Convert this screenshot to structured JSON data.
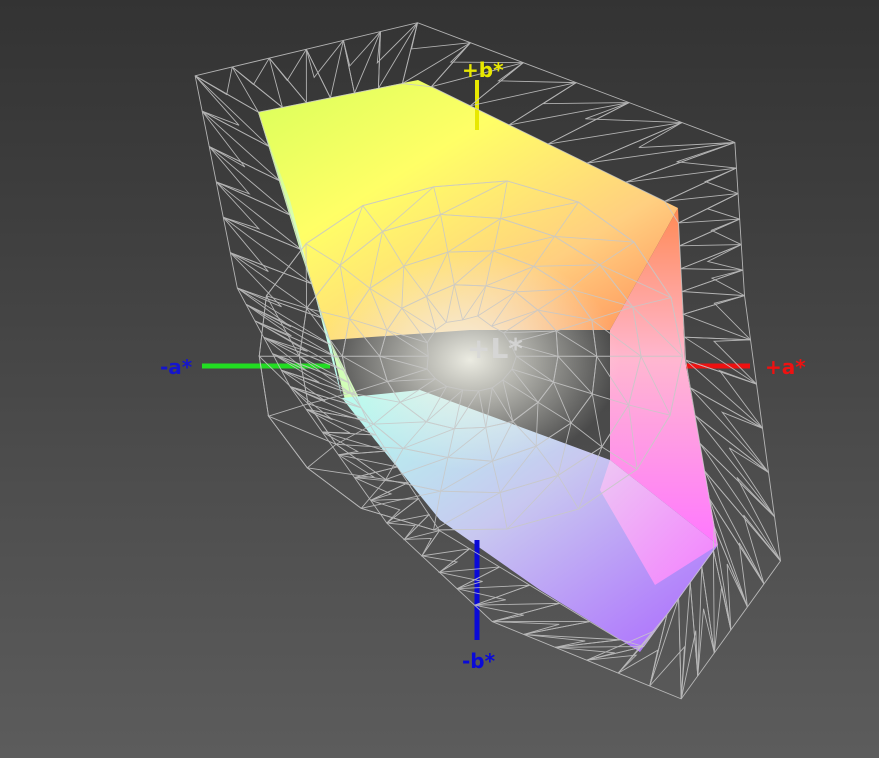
{
  "axes": {
    "plus_b": {
      "label": "+b*",
      "color": "#e8e800"
    },
    "minus_b": {
      "label": "-b*",
      "color": "#0a0ad8"
    },
    "plus_a": {
      "label": "+a*",
      "color": "#ee1111"
    },
    "minus_a": {
      "label": "-a*",
      "color": "#1515cc"
    },
    "l": {
      "label": "+L*",
      "color": "#d8d8d8"
    }
  },
  "axis_line_colors": {
    "b": "#0a0ad8",
    "a_positive": "#ee1111",
    "a_negative": "#22dd22",
    "b_positive": "#e8e800"
  },
  "gamut": {
    "wireframe_color": "#c8c8c8",
    "corner_colors": {
      "yellow_green": "#d8ff5a",
      "yellow": "#ffff55",
      "orange": "#ff8a50",
      "magenta": "#ff66ff",
      "violet": "#aa66ff",
      "cyan": "#a8ffff",
      "white": "#f2f2f2"
    }
  }
}
